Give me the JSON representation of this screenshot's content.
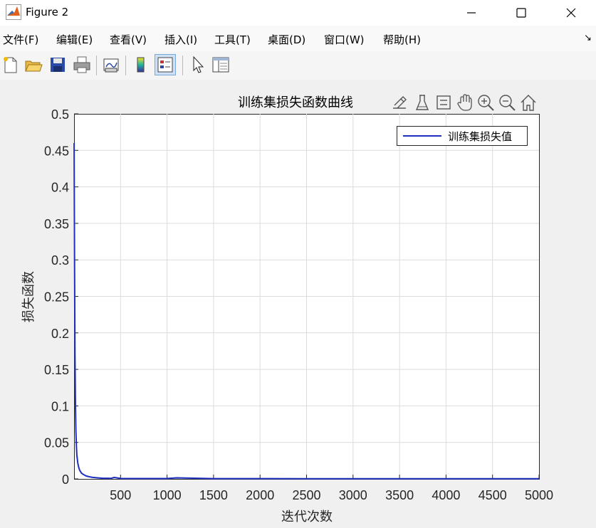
{
  "window": {
    "title": "Figure 2",
    "icons": {
      "app": "matlab-logo-icon",
      "minimize": "minimize-icon",
      "maximize": "maximize-icon",
      "close": "close-icon"
    }
  },
  "menu": {
    "items": [
      "文件(F)",
      "编辑(E)",
      "查看(V)",
      "插入(I)",
      "工具(T)",
      "桌面(D)",
      "窗口(W)",
      "帮助(H)"
    ],
    "overflow_glyph": "↘"
  },
  "toolbar": {
    "buttons": [
      "new-figure-icon",
      "open-file-icon",
      "save-icon",
      "print-icon",
      "link-plot-icon",
      "insert-colorbar-icon",
      "insert-legend-icon",
      "edit-plot-icon",
      "property-inspector-icon"
    ]
  },
  "axes_toolbar": {
    "buttons": [
      "brush-edit-icon",
      "data-tips-icon",
      "rotate-icon",
      "pan-hand-icon",
      "zoom-in-icon",
      "zoom-out-icon",
      "home-icon"
    ]
  },
  "colors": {
    "series": "#1f2fbf",
    "grid": "#dcdcdc",
    "axis": "#262626"
  },
  "chart_data": {
    "type": "line",
    "title": "训练集损失函数曲线",
    "xlabel": "迭代次数",
    "ylabel": "损失函数",
    "xlim": [
      0,
      5000
    ],
    "ylim": [
      0,
      0.5
    ],
    "xticks": [
      500,
      1000,
      1500,
      2000,
      2500,
      3000,
      3500,
      4000,
      4500,
      5000
    ],
    "yticks": [
      0,
      0.05,
      0.1,
      0.15,
      0.2,
      0.25,
      0.3,
      0.35,
      0.4,
      0.45,
      0.5
    ],
    "grid": true,
    "legend_position": "top-right",
    "series": [
      {
        "name": "训练集损失值",
        "x": [
          1,
          5,
          10,
          15,
          20,
          25,
          30,
          40,
          50,
          60,
          80,
          100,
          130,
          160,
          200,
          250,
          300,
          400,
          430,
          500,
          700,
          1000,
          1100,
          1500,
          2000,
          2500,
          3000,
          3500,
          4000,
          4500,
          5000
        ],
        "y": [
          0.46,
          0.3,
          0.17,
          0.1,
          0.065,
          0.045,
          0.033,
          0.022,
          0.016,
          0.012,
          0.008,
          0.006,
          0.004,
          0.003,
          0.002,
          0.0015,
          0.001,
          0.0008,
          0.002,
          0.0006,
          0.0005,
          0.0005,
          0.0015,
          0.0004,
          0.0004,
          0.0003,
          0.0003,
          0.0003,
          0.0003,
          0.0003,
          0.0003
        ]
      }
    ]
  }
}
